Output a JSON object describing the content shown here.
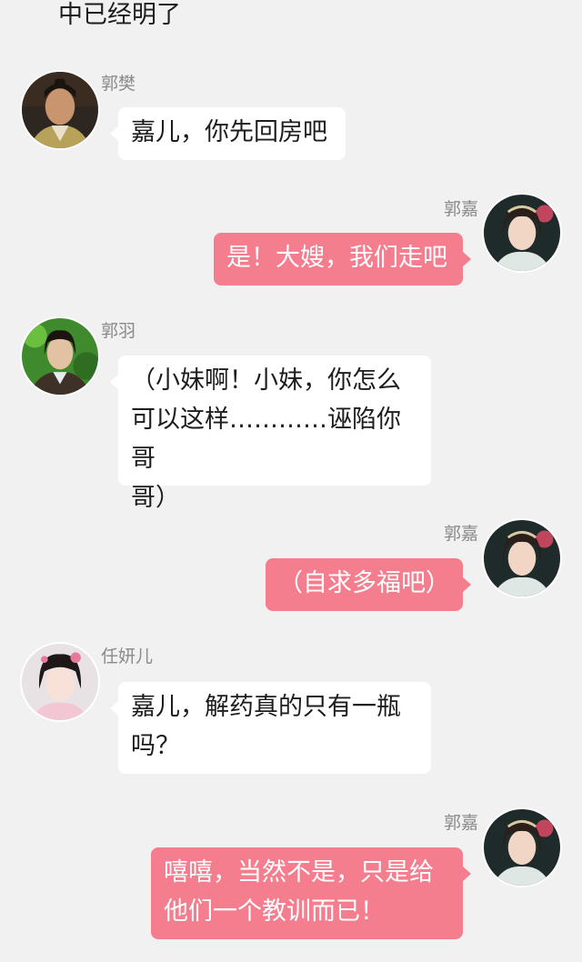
{
  "header": {
    "text": "中已经明了"
  },
  "colors": {
    "background": "#f1f1f1",
    "left_bubble": "#ffffff",
    "right_bubble": "#f47d8e"
  },
  "messages": [
    {
      "side": "left",
      "sender": "郭樊",
      "text": "嘉儿，你先回房吧"
    },
    {
      "side": "right",
      "sender": "郭嘉",
      "text": "是！大嫂，我们走吧"
    },
    {
      "side": "left",
      "sender": "郭羽",
      "text": "（小妹啊！小妹，你怎么\n可以这样…………诬陷你哥\n哥）"
    },
    {
      "side": "right",
      "sender": "郭嘉",
      "text": "（自求多福吧）"
    },
    {
      "side": "left",
      "sender": "任妍儿",
      "text": "嘉儿，解药真的只有一瓶\n吗？"
    },
    {
      "side": "right",
      "sender": "郭嘉",
      "text": "嘻嘻，当然不是，只是给\n他们一个教训而已！"
    }
  ]
}
